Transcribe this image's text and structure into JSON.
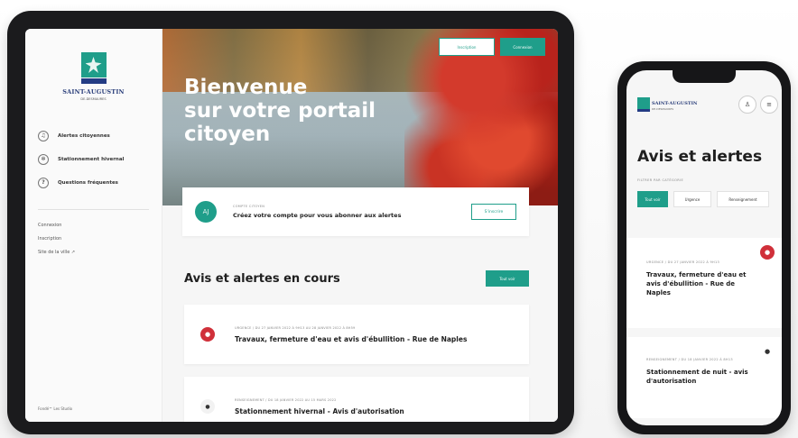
{
  "brand": {
    "name": "SAINT-AUGUSTIN",
    "subtitle": "DE-DESMAURES",
    "accent": "#1f9e8a",
    "navy": "#243c84",
    "alert_red": "#d0303a"
  },
  "tablet": {
    "nav": [
      {
        "label": "Alertes citoyennes",
        "icon": "bell-icon"
      },
      {
        "label": "Stationnement hivernal",
        "icon": "snowflake-icon"
      },
      {
        "label": "Questions fréquentes",
        "icon": "question-icon"
      }
    ],
    "links": [
      "Connexion",
      "Inscription",
      "Site de la ville ↗"
    ],
    "footer": "Fondé™ Les Studio",
    "header_buttons": {
      "outline": "Inscription",
      "solid": "Connexion"
    },
    "hero_title_lines": [
      "Bienvenue",
      "sur votre portail",
      "citoyen"
    ],
    "signup_card": {
      "avatar": "AJ",
      "eyebrow": "COMPTE CITOYEN",
      "text": "Créez votre compte pour vous abonner aux alertes",
      "button": "S'inscrire"
    },
    "section_title": "Avis et alertes en cours",
    "section_button": "Tout voir",
    "alerts": [
      {
        "meta": "URGENCE / DU 27 JANVIER 2022 À 9H13 AU 28 JANVIER 2022 À 8H59",
        "title": "Travaux, fermeture d'eau et avis d'ébullition - Rue de Naples",
        "icon": "drop-icon"
      },
      {
        "meta": "RENSEIGNEMENT / DU 18 JANVIER 2022 AU 15 MARS 2022",
        "title": "Stationnement hivernal - Avis d'autorisation",
        "icon": "info-icon"
      }
    ]
  },
  "phone": {
    "logo_text": "SAINT-AUGUSTIN",
    "logo_sub": "DE-DESMAURES",
    "title": "Avis et alertes",
    "filter_label": "FILTRER PAR CATÉGORIE",
    "filters": [
      "Tout voir",
      "Urgence",
      "Renseignement"
    ],
    "cards": [
      {
        "meta": "URGENCE / DU 27 JANVIER 2022 À 9H13",
        "title": "Travaux, fermeture d'eau et avis d'ébullition - Rue de Naples"
      },
      {
        "meta": "RENSEIGNEMENT / DU 18 JANVIER 2022 À 8H13",
        "title": "Stationnement de nuit - avis d'autorisation"
      }
    ]
  }
}
